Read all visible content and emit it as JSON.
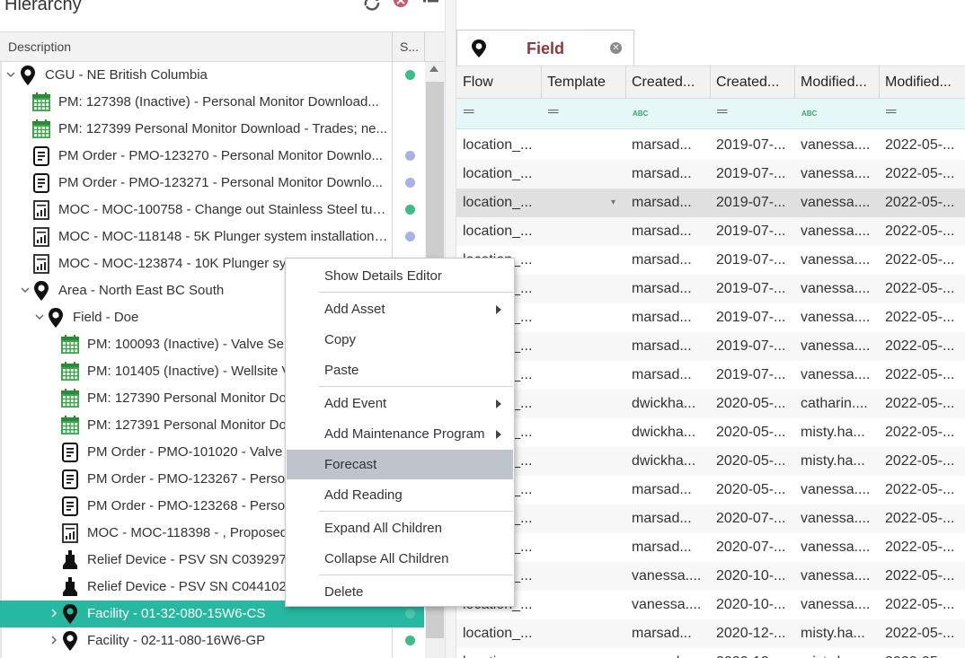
{
  "left": {
    "title": "Hierarchy",
    "col_description": "Description",
    "col_status": "S...",
    "rows": [
      {
        "label": "CGU - NE British Columbia",
        "icon": "location-pin-icon",
        "indent": 0,
        "chevron": "down",
        "status": "#3dbb88"
      },
      {
        "label": "PM: 127398  (Inactive) - Personal Monitor Download...",
        "icon": "calendar-icon",
        "indent": 1,
        "chevron": "",
        "status": ""
      },
      {
        "label": "PM: 127399  Personal Monitor Download - Trades; ne...",
        "icon": "calendar-icon",
        "indent": 1,
        "chevron": "",
        "status": ""
      },
      {
        "label": "PM Order - PMO-123270 -  Personal Monitor Downlo...",
        "icon": "work-order-icon",
        "indent": 1,
        "chevron": "",
        "status": "#a8b0e8"
      },
      {
        "label": "PM Order - PMO-123271 -  Personal Monitor Downlo...",
        "icon": "work-order-icon",
        "indent": 1,
        "chevron": "",
        "status": "#a8b0e8"
      },
      {
        "label": "MOC - MOC-100758 - Change out Stainless Steel tubi...",
        "icon": "moc-document-icon",
        "indent": 1,
        "chevron": "",
        "status": "#3dbb88"
      },
      {
        "label": "MOC - MOC-118148 - 5K Plunger system installations...",
        "icon": "moc-document-icon",
        "indent": 1,
        "chevron": "",
        "status": "#a8b0e8"
      },
      {
        "label": "MOC - MOC-123874 - 10K Plunger sys",
        "icon": "moc-document-icon",
        "indent": 1,
        "chevron": "",
        "status": ""
      },
      {
        "label": "Area - North East BC South",
        "icon": "location-pin-icon",
        "indent": 1,
        "chevron": "down",
        "status": ""
      },
      {
        "label": "Field - Doe",
        "icon": "location-pin-icon",
        "indent": 2,
        "chevron": "down",
        "status": ""
      },
      {
        "label": "PM: 100093  (Inactive) - Valve Ser",
        "icon": "calendar-icon",
        "indent": 3,
        "chevron": "",
        "status": ""
      },
      {
        "label": "PM: 101405  (Inactive) - Wellsite V",
        "icon": "calendar-icon",
        "indent": 3,
        "chevron": "",
        "status": ""
      },
      {
        "label": "PM: 127390  Personal Monitor Do",
        "icon": "calendar-icon",
        "indent": 3,
        "chevron": "",
        "status": ""
      },
      {
        "label": "PM: 127391  Personal Monitor Do",
        "icon": "calendar-icon",
        "indent": 3,
        "chevron": "",
        "status": ""
      },
      {
        "label": "PM Order - PMO-101020 -  Valve",
        "icon": "work-order-icon",
        "indent": 3,
        "chevron": "",
        "status": ""
      },
      {
        "label": "PM Order - PMO-123267 -  Perso",
        "icon": "work-order-icon",
        "indent": 3,
        "chevron": "",
        "status": ""
      },
      {
        "label": "PM Order - PMO-123268 -  Perso",
        "icon": "work-order-icon",
        "indent": 3,
        "chevron": "",
        "status": ""
      },
      {
        "label": "MOC - MOC-118398 -  , Proposed",
        "icon": "moc-document-icon",
        "indent": 3,
        "chevron": "",
        "status": ""
      },
      {
        "label": "Relief Device - PSV SN C039297, ",
        "icon": "relief-valve-icon",
        "indent": 3,
        "chevron": "",
        "status": ""
      },
      {
        "label": "Relief Device - PSV SN C044102, ",
        "icon": "relief-valve-icon",
        "indent": 3,
        "chevron": "",
        "status": ""
      },
      {
        "label": "Facility -  01-32-080-15W6-CS",
        "icon": "location-pin-icon",
        "indent": 3,
        "chevron": "right",
        "status": "#3dbb88",
        "selected": true
      },
      {
        "label": "Facility -  02-11-080-16W6-GP",
        "icon": "location-pin-icon",
        "indent": 3,
        "chevron": "right",
        "status": "#3dbb88"
      }
    ]
  },
  "right": {
    "tab_label": "Field",
    "columns": [
      "Flow",
      "Template",
      "Created...",
      "Created...",
      "Modified...",
      "Modified..."
    ],
    "filters": [
      "eq",
      "eq",
      "abc",
      "eq",
      "abc",
      "eq"
    ],
    "rows": [
      [
        "location_...",
        "",
        "marsad...",
        "2019-07-...",
        "vanessa....",
        "2022-05-..."
      ],
      [
        "location_...",
        "",
        "marsad...",
        "2019-07-...",
        "vanessa....",
        "2022-05-..."
      ],
      [
        "location_...",
        "",
        "marsad...",
        "2019-07-...",
        "vanessa....",
        "2022-05-..."
      ],
      [
        "location_...",
        "",
        "marsad...",
        "2019-07-...",
        "vanessa....",
        "2022-05-..."
      ],
      [
        "location_...",
        "",
        "marsad...",
        "2019-07-...",
        "vanessa....",
        "2022-05-..."
      ],
      [
        "location_...",
        "",
        "marsad...",
        "2019-07-...",
        "vanessa....",
        "2022-05-..."
      ],
      [
        "location_...",
        "",
        "marsad...",
        "2019-07-...",
        "vanessa....",
        "2022-05-..."
      ],
      [
        "location_...",
        "",
        "marsad...",
        "2019-07-...",
        "vanessa....",
        "2022-05-..."
      ],
      [
        "location_...",
        "",
        "marsad...",
        "2019-07-...",
        "vanessa....",
        "2022-05-..."
      ],
      [
        "location_...",
        "",
        "dwickha...",
        "2020-05-...",
        "catharin....",
        "2022-05-..."
      ],
      [
        "location_...",
        "",
        "dwickha...",
        "2020-05-...",
        "misty.ha...",
        "2022-05-..."
      ],
      [
        "location_...",
        "",
        "dwickha...",
        "2020-05-...",
        "misty.ha...",
        "2022-05-..."
      ],
      [
        "location_...",
        "",
        "marsad...",
        "2020-05-...",
        "vanessa....",
        "2022-05-..."
      ],
      [
        "location_...",
        "",
        "marsad...",
        "2020-07-...",
        "vanessa....",
        "2022-05-..."
      ],
      [
        "location_...",
        "",
        "marsad...",
        "2020-07-...",
        "vanessa....",
        "2022-05-..."
      ],
      [
        "location_...",
        "",
        "vanessa....",
        "2020-10-...",
        "vanessa....",
        "2022-05-..."
      ],
      [
        "location_...",
        "",
        "vanessa....",
        "2020-10-...",
        "vanessa....",
        "2022-05-..."
      ],
      [
        "location_...",
        "",
        "marsad...",
        "2020-12-...",
        "misty.ha...",
        "2022-05-..."
      ],
      [
        "location_...",
        "",
        "marsad...",
        "2020-12-...",
        "misty.ha...",
        "2022-05-..."
      ]
    ]
  },
  "context_menu": {
    "items": [
      {
        "label": "Show Details Editor",
        "submenu": false,
        "sep_after": true
      },
      {
        "label": "Add Asset",
        "submenu": true,
        "sep_after": false
      },
      {
        "label": "Copy",
        "submenu": false,
        "sep_after": false
      },
      {
        "label": "Paste",
        "submenu": false,
        "sep_after": true
      },
      {
        "label": "Add Event",
        "submenu": true,
        "sep_after": false
      },
      {
        "label": "Add Maintenance Program",
        "submenu": true,
        "sep_after": false
      },
      {
        "label": "Forecast",
        "submenu": false,
        "sep_after": false,
        "active": true
      },
      {
        "label": "Add Reading",
        "submenu": false,
        "sep_after": true
      },
      {
        "label": "Expand All Children",
        "submenu": false,
        "sep_after": false
      },
      {
        "label": "Collapse All Children",
        "submenu": false,
        "sep_after": true
      },
      {
        "label": "Delete",
        "submenu": false,
        "sep_after": false
      }
    ]
  }
}
